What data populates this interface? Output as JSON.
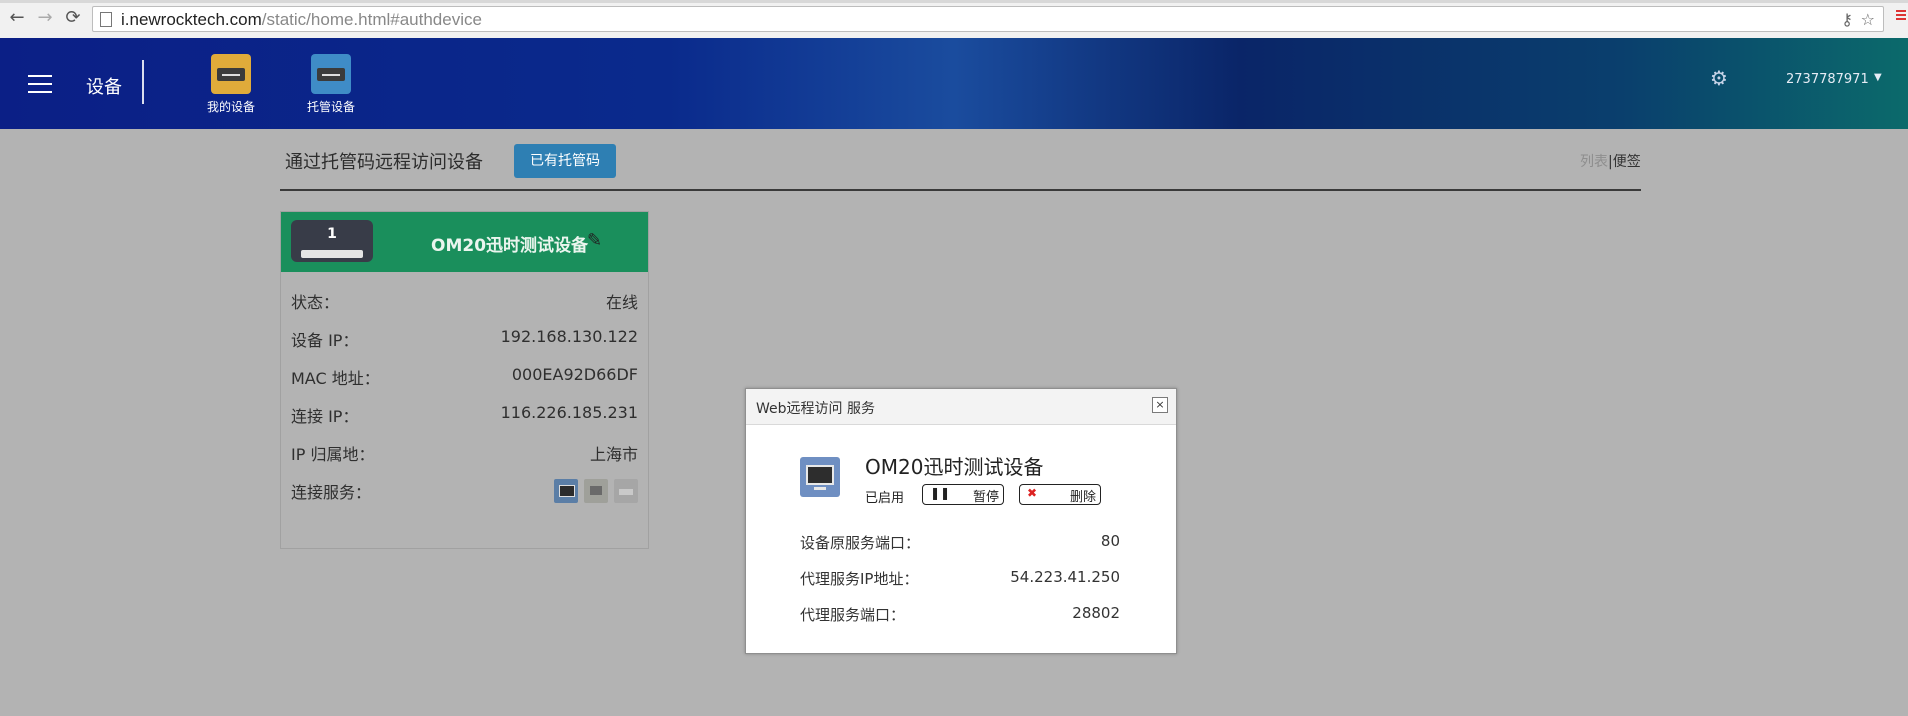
{
  "browser": {
    "url_host": "i.newrocktech.com",
    "url_path": "/static/home.html#authdevice"
  },
  "header": {
    "title": "设备",
    "nav": [
      {
        "label": "我的设备"
      },
      {
        "label": "托管设备"
      }
    ],
    "username": "2737787971"
  },
  "page": {
    "section_title": "通过托管码远程访问设备",
    "have_code_button": "已有托管码",
    "view_list": "列表",
    "view_separator": "|",
    "view_note": "便签"
  },
  "device_card": {
    "number": "1",
    "name": "OM20迅时测试设备",
    "rows": [
      {
        "label": "状态：",
        "value": "在线"
      },
      {
        "label": "设备 IP：",
        "value": "192.168.130.122"
      },
      {
        "label": "MAC 地址：",
        "value": "000EA92D66DF"
      },
      {
        "label": "连接 IP：",
        "value": "116.226.185.231"
      },
      {
        "label": "IP 归属地：",
        "value": "上海市"
      },
      {
        "label": "连接服务：",
        "value": ""
      }
    ]
  },
  "modal": {
    "title": "Web远程访问 服务",
    "close": "×",
    "device_name": "OM20迅时测试设备",
    "status": "已启用",
    "pause_label": "暂停",
    "delete_label": "删除",
    "rows": [
      {
        "label": "设备原服务端口：",
        "value": "80"
      },
      {
        "label": "代理服务IP地址：",
        "value": "54.223.41.250"
      },
      {
        "label": "代理服务端口：",
        "value": "28802"
      }
    ]
  },
  "colors": {
    "card_header": "#1a8f5c",
    "primary_button": "#2e7fb3",
    "overlay": "#b3b3b3"
  }
}
